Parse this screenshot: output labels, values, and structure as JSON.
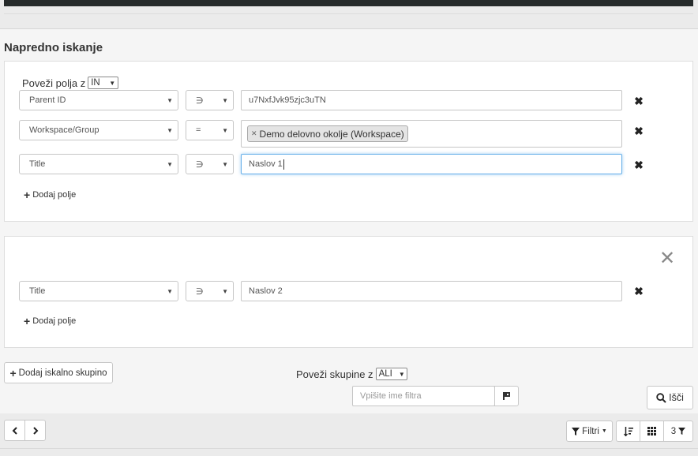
{
  "page": {
    "title": "Napredno iskanje"
  },
  "group1": {
    "connect": {
      "label": "Poveži polja z",
      "value": "IN"
    },
    "rows": [
      {
        "field": "Parent ID",
        "operator": "∋",
        "value": "u7NxfJvk95zjc3uTN"
      },
      {
        "field": "Workspace/Group",
        "operator": "=",
        "token": "Demo delovno okolje (Workspace)"
      },
      {
        "field": "Title",
        "operator": "∋",
        "value": "Naslov 1"
      }
    ],
    "add_field": "Dodaj polje"
  },
  "group2": {
    "rows": [
      {
        "field": "Title",
        "operator": "∋",
        "value": "Naslov 2"
      }
    ],
    "add_field": "Dodaj polje"
  },
  "footer": {
    "add_group": "Dodaj iskalno skupino",
    "connect_groups": {
      "label": "Poveži skupine z",
      "value": "ALI"
    },
    "filter_name_placeholder": "Vpišite ime filtra",
    "search_button": "Išči"
  },
  "toolbar": {
    "filters_label": "Filtri",
    "filter_count": "3"
  }
}
